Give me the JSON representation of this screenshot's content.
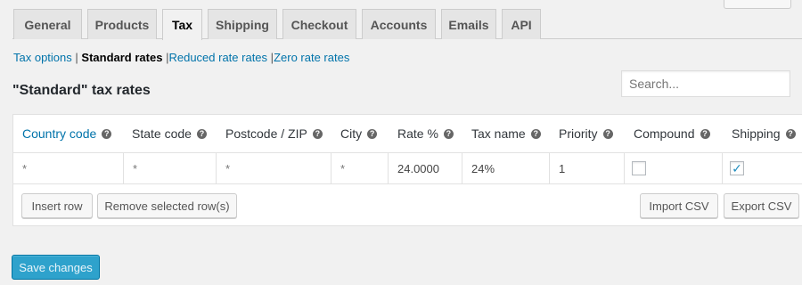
{
  "tabs": [
    {
      "label": "General",
      "active": false
    },
    {
      "label": "Products",
      "active": false
    },
    {
      "label": "Tax",
      "active": true
    },
    {
      "label": "Shipping",
      "active": false
    },
    {
      "label": "Checkout",
      "active": false
    },
    {
      "label": "Accounts",
      "active": false
    },
    {
      "label": "Emails",
      "active": false
    },
    {
      "label": "API",
      "active": false
    }
  ],
  "subnav": {
    "tax_options": "Tax options",
    "standard_rates": "Standard rates",
    "reduced_rates": "Reduced rate rates",
    "zero_rates": "Zero rate rates",
    "separator": "|"
  },
  "title": "\"Standard\" tax rates",
  "search": {
    "placeholder": "Search..."
  },
  "columns": [
    "Country code",
    "State code",
    "Postcode / ZIP",
    "City",
    "Rate %",
    "Tax name",
    "Priority",
    "Compound",
    "Shipping"
  ],
  "row": {
    "country": "*",
    "state": "*",
    "postcode": "*",
    "city": "*",
    "rate": "24.0000",
    "tax_name": "24%",
    "priority": "1",
    "compound": false,
    "shipping": true
  },
  "buttons": {
    "insert_row": "Insert row",
    "remove_rows": "Remove selected row(s)",
    "import_csv": "Import CSV",
    "export_csv": "Export CSV",
    "save_changes": "Save changes"
  },
  "colors": {
    "link": "#0073aa",
    "primary": "#2ea2cc"
  }
}
